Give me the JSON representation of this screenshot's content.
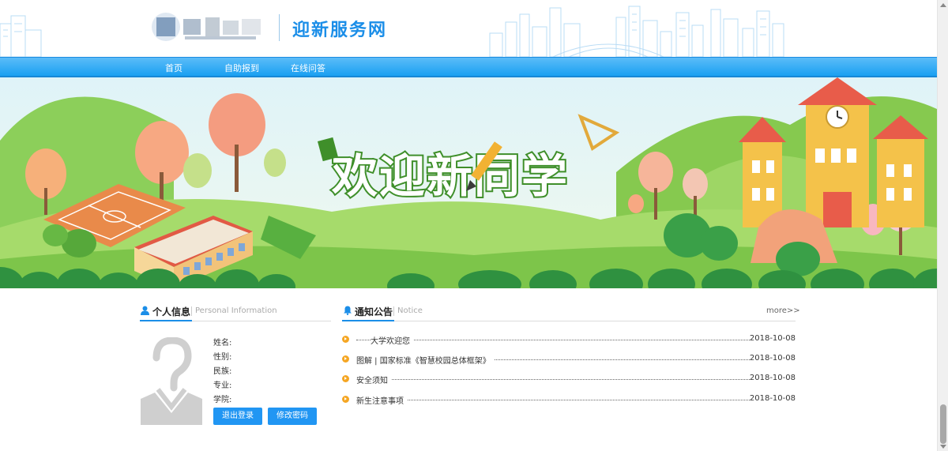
{
  "header": {
    "site_title": "迎新服务网",
    "logo_icon": "university-logo-icon"
  },
  "nav": {
    "items": [
      {
        "label": "首页"
      },
      {
        "label": "自助报到"
      },
      {
        "label": "在线问答"
      }
    ]
  },
  "banner": {
    "headline": "欢迎新同学"
  },
  "personal": {
    "title": "个人信息",
    "subtitle": "Personal Information",
    "icon": "user-icon",
    "fields": [
      {
        "label": "姓名:"
      },
      {
        "label": "性别:"
      },
      {
        "label": "民族:"
      },
      {
        "label": "专业:"
      },
      {
        "label": "学院:"
      }
    ],
    "logout_label": "退出登录",
    "change_password_label": "修改密码"
  },
  "notice": {
    "title": "通知公告",
    "subtitle": "Notice",
    "icon": "bell-icon",
    "more_label": "more>>",
    "items": [
      {
        "text": "大学欢迎您",
        "date": "2018-10-08"
      },
      {
        "text": "图解 | 国家标准《智慧校园总体框架》",
        "date": "2018-10-08"
      },
      {
        "text": "安全须知",
        "date": "2018-10-08"
      },
      {
        "text": "新生注意事项",
        "date": "2018-10-08"
      }
    ]
  },
  "colors": {
    "accent": "#1b8ee8",
    "nav": "#1aa0f2",
    "button": "#2196f3",
    "bullet": "#f5a623"
  }
}
